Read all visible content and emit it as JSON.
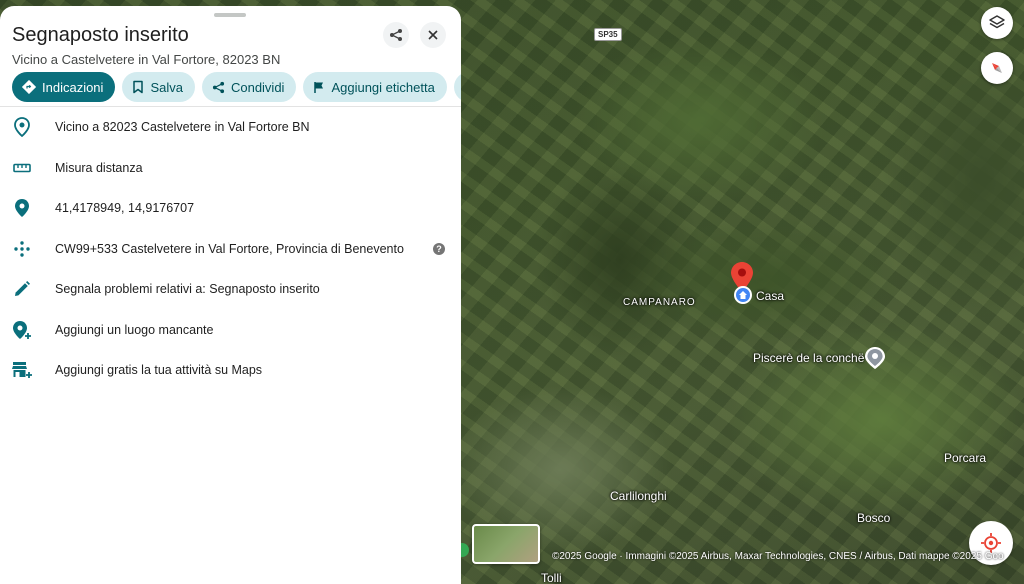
{
  "panel": {
    "title": "Segnaposto inserito",
    "subtitle": "Vicino a Castelvetere in Val Fortore, 82023 BN",
    "chips": [
      {
        "label": "Indicazioni",
        "icon": "directions-icon"
      },
      {
        "label": "Salva",
        "icon": "bookmark-icon"
      },
      {
        "label": "Condividi",
        "icon": "share-icon"
      },
      {
        "label": "Aggiungi etichetta",
        "icon": "flag-icon"
      }
    ],
    "rows": [
      {
        "label": "Vicino a 82023 Castelvetere in Val Fortore BN",
        "icon": "location-outline-icon"
      },
      {
        "label": "Misura distanza",
        "icon": "ruler-icon"
      },
      {
        "label": "41,4178949, 14,9176707",
        "icon": "location-pin-icon"
      },
      {
        "label": "CW99+533 Castelvetere in Val Fortore, Provincia di Benevento",
        "icon": "plus-code-icon"
      },
      {
        "label": "Segnala problemi relativi a: Segnaposto inserito",
        "icon": "edit-icon"
      },
      {
        "label": "Aggiungi un luogo mancante",
        "icon": "add-place-icon"
      },
      {
        "label": "Aggiungi gratis la tua attività su Maps",
        "icon": "add-business-icon"
      }
    ],
    "help_glyph": "?"
  },
  "map": {
    "road_badge": "SP35",
    "labels": {
      "campanaro": "CAMPANARO",
      "casa": "Casa",
      "piscere": "Piscerè de la conchë",
      "porcara": "Porcara",
      "carlilonghi": "Carlilonghi",
      "bosco": "Bosco",
      "tolli": "Tolli"
    },
    "attribution": "©2025 Google · Immagini ©2025 Airbus, Maxar Technologies, CNES / Airbus, Dati mappe ©2025 Goo"
  },
  "colors": {
    "accent": "#0b6f7c",
    "chip_bg": "#d3ebef",
    "pin_red": "#ea4335",
    "home_blue": "#4285f4"
  }
}
